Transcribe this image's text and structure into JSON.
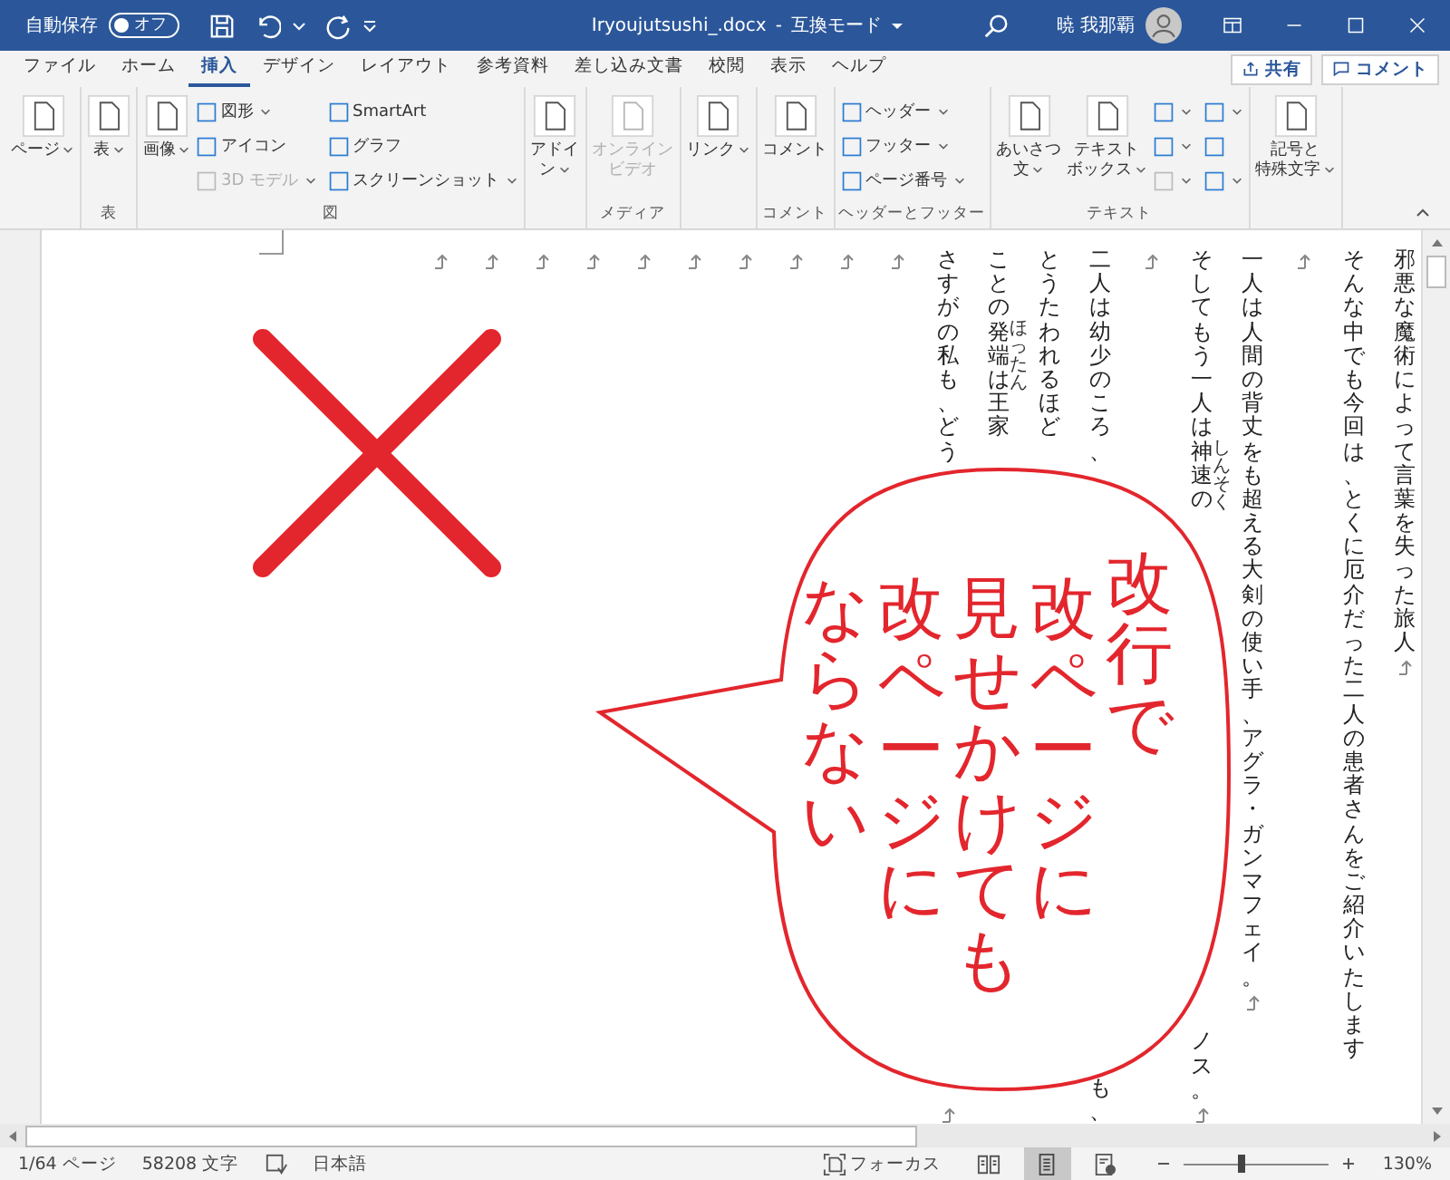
{
  "title_bar": {
    "autosave_label": "自動保存",
    "autosave": {
      "label": "オフ",
      "on": false
    },
    "document_title": "Iryoujutsushi_.docx",
    "separator": "-",
    "mode": "互換モード",
    "user_name": "暁 我那覇"
  },
  "tabs": [
    {
      "label": "ファイル",
      "selected": false
    },
    {
      "label": "ホーム",
      "selected": false
    },
    {
      "label": "挿入",
      "selected": true
    },
    {
      "label": "デザイン",
      "selected": false
    },
    {
      "label": "レイアウト",
      "selected": false
    },
    {
      "label": "参考資料",
      "selected": false
    },
    {
      "label": "差し込み文書",
      "selected": false
    },
    {
      "label": "校閲",
      "selected": false
    },
    {
      "label": "表示",
      "selected": false
    },
    {
      "label": "ヘルプ",
      "selected": false
    }
  ],
  "share_button": "共有",
  "comment_button": "コメント",
  "ribbon": {
    "groups": [
      {
        "items": [
          {
            "kind": "large",
            "label": [
              "ページ"
            ],
            "dropdown": true,
            "disabled": false
          }
        ]
      },
      {
        "label": "表",
        "items": [
          {
            "kind": "large",
            "label": [
              "表"
            ],
            "dropdown": true,
            "disabled": false
          }
        ]
      },
      {
        "label": "図",
        "items": [
          {
            "kind": "large",
            "label": [
              "画像"
            ],
            "dropdown": true,
            "disabled": false
          },
          {
            "kind": "small",
            "label": "図形",
            "dropdown": true,
            "disabled": false
          },
          {
            "kind": "small",
            "label": "アイコン",
            "dropdown": false,
            "disabled": false
          },
          {
            "kind": "small",
            "label": "3D モデル",
            "dropdown": true,
            "disabled": true
          },
          {
            "kind": "small",
            "label": "SmartArt",
            "dropdown": false,
            "disabled": false
          },
          {
            "kind": "small",
            "label": "グラフ",
            "dropdown": false,
            "disabled": false
          },
          {
            "kind": "small",
            "label": "スクリーンショット",
            "dropdown": true,
            "disabled": false
          }
        ]
      },
      {
        "items": [
          {
            "kind": "large",
            "label": [
              "アドイ",
              "ン"
            ],
            "dropdown": true,
            "disabled": false
          }
        ]
      },
      {
        "label": "メディア",
        "items": [
          {
            "kind": "large",
            "label": [
              "オンライン",
              "ビデオ"
            ],
            "dropdown": false,
            "disabled": true
          }
        ]
      },
      {
        "items": [
          {
            "kind": "large",
            "label": [
              "リンク"
            ],
            "dropdown": true,
            "disabled": false
          }
        ]
      },
      {
        "label": "コメント",
        "items": [
          {
            "kind": "large",
            "label": [
              "コメント"
            ],
            "dropdown": false,
            "disabled": false
          }
        ]
      },
      {
        "label": "ヘッダーとフッター",
        "items": [
          {
            "kind": "small",
            "label": "ヘッダー",
            "dropdown": true,
            "disabled": false
          },
          {
            "kind": "small",
            "label": "フッター",
            "dropdown": true,
            "disabled": false
          },
          {
            "kind": "small",
            "label": "ページ番号",
            "dropdown": true,
            "disabled": false
          }
        ]
      },
      {
        "label": "テキスト",
        "items": [
          {
            "kind": "large",
            "label": [
              "あいさつ",
              "文"
            ],
            "dropdown": true,
            "disabled": false
          },
          {
            "kind": "large",
            "label": [
              "テキスト",
              "ボックス"
            ],
            "dropdown": true,
            "disabled": false
          },
          {
            "kind": "small",
            "dropdown": true,
            "disabled": false
          },
          {
            "kind": "small",
            "dropdown": true,
            "disabled": false
          },
          {
            "kind": "small",
            "dropdown": true,
            "disabled": true
          },
          {
            "kind": "small",
            "dropdown": true,
            "disabled": false
          },
          {
            "kind": "small",
            "dropdown": false,
            "disabled": false
          },
          {
            "kind": "small",
            "dropdown": true,
            "disabled": false
          }
        ]
      },
      {
        "items": [
          {
            "kind": "large",
            "label": [
              "記号と",
              "特殊文字"
            ],
            "dropdown": true,
            "disabled": false
          }
        ]
      }
    ]
  },
  "document": {
    "columns": [
      {
        "mark": true
      },
      {
        "mark": true
      },
      {
        "mark": true
      },
      {
        "mark": true
      },
      {
        "mark": true
      },
      {
        "mark": true
      },
      {
        "mark": true
      },
      {
        "mark": true
      },
      {
        "mark": true
      },
      {
        "mark": true
      },
      {
        "parts": [
          [
            {
              "text": "さすがの私も、どう"
            }
          ]
        ],
        "continues": true,
        "mark": true
      },
      {
        "parts": [
          [
            {
              "text": "ことの"
            },
            {
              "text": "発端",
              "ruby": "ほったん"
            },
            {
              "text": "は王家"
            }
          ]
        ]
      },
      {
        "parts": [
          [
            {
              "text": "とうたわれるほど"
            }
          ]
        ]
      },
      {
        "parts": [
          [
            {
              "text": "二人は幼少のころ、"
            }
          ],
          [
            {
              "text": "も、"
            }
          ]
        ],
        "continues": true
      },
      {
        "mark": true
      },
      {
        "parts": [
          [
            {
              "text": "そしてもう一人は"
            },
            {
              "text": "神速",
              "ruby": "しんそく"
            },
            {
              "text": "の"
            }
          ],
          [
            {
              "text": "ノス。"
            }
          ]
        ],
        "continues": true,
        "mark": true
      },
      {
        "parts": [
          [
            {
              "text": "一人は人間の背丈をも超える大剣の使い手、アグラ・ガンマフェイ。"
            }
          ]
        ],
        "mark": true
      },
      {
        "mark": true
      },
      {
        "parts": [
          [
            {
              "text": "そんな中でも今回は、とくに厄介だった二人の患者さんをご紹介いたします"
            }
          ]
        ]
      },
      {
        "parts": [
          [
            {
              "text": "邪悪な魔術によって言葉を失った旅人"
            }
          ]
        ],
        "mark": true
      }
    ]
  },
  "callout": {
    "lines": [
      "ならない",
      "改ページに",
      "見せかけても",
      "改ページに",
      "改行で"
    ]
  },
  "status_bar": {
    "page": "1/64 ページ",
    "words": "58208 文字",
    "language": "日本語",
    "focus": "フォーカス",
    "views": [
      {
        "kind": "read",
        "selected": false
      },
      {
        "kind": "print",
        "selected": true
      },
      {
        "kind": "web",
        "selected": false
      }
    ],
    "zoom": {
      "level": 0.4,
      "reading": "130%"
    }
  }
}
